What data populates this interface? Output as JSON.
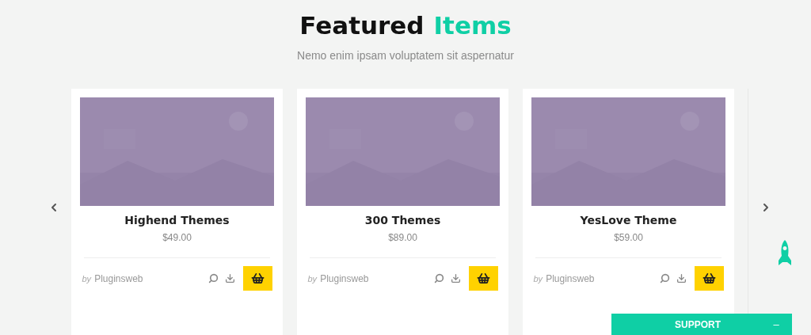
{
  "heading": {
    "title": "Featured",
    "highlight": "Items",
    "subtitle": "Nemo enim ipsam voluptatem sit aspernatur"
  },
  "products": [
    {
      "kind": "picture",
      "name": "Highend Themes",
      "price": "$49.00",
      "by": "by",
      "author": "Pluginsweb"
    },
    {
      "kind": "picture",
      "name": "300 Themes",
      "price": "$89.00",
      "by": "by",
      "author": "Pluginsweb"
    },
    {
      "kind": "picture",
      "name": "YesLove Theme",
      "price": "$59.00",
      "by": "by",
      "author": "Pluginsweb"
    }
  ],
  "support": {
    "label": "SUPPORT",
    "toggle": "–"
  }
}
